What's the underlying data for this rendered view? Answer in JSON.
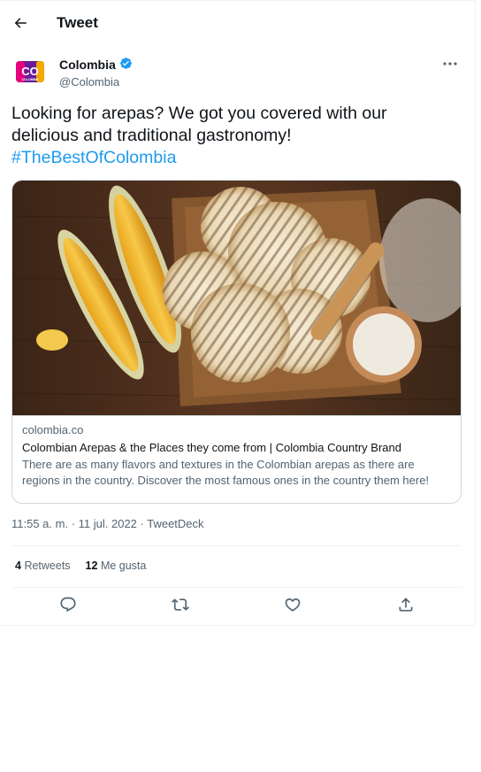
{
  "header": {
    "title": "Tweet"
  },
  "author": {
    "display_name": "Colombia",
    "handle": "@Colombia",
    "avatar_text": "CO",
    "avatar_subtext": "COLOMBIA"
  },
  "tweet": {
    "text": "Looking for arepas? We got you covered with our delicious and traditional gastronomy!",
    "hashtag": "#TheBestOfColombia"
  },
  "card": {
    "domain": "colombia.co",
    "title": "Colombian Arepas & the Places they come from | Colombia Country Brand",
    "description": "There are as many flavors and textures in the Colombian arepas as there are regions in the country. Discover the most famous ones in the country them here!"
  },
  "meta": {
    "time": "11:55 a. m.",
    "date": "11 jul. 2022",
    "source": "TweetDeck",
    "separator": " · "
  },
  "stats": {
    "retweets_count": "4",
    "retweets_label": "Retweets",
    "likes_count": "12",
    "likes_label": "Me gusta"
  },
  "icons": [
    "back-arrow-icon",
    "verified-badge-icon",
    "more-icon",
    "reply-icon",
    "retweet-icon",
    "like-icon",
    "share-icon"
  ],
  "colors": {
    "accent": "#1d9bf0",
    "text": "#0f1419",
    "secondary": "#536471",
    "border": "#cfd9de"
  }
}
